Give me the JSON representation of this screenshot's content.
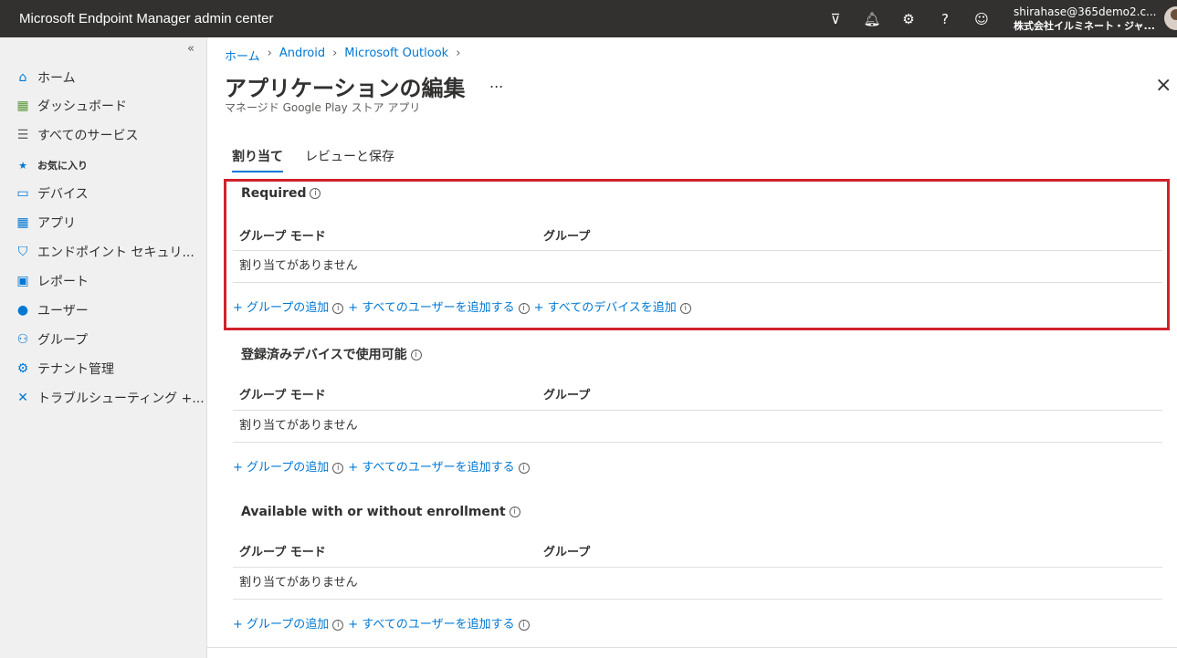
{
  "topbar": {
    "title": "Microsoft Endpoint Manager admin center",
    "user_email": "shirahase@365demo2.c...",
    "user_tenant": "株式会社イルミネート・ジャ..."
  },
  "sidebar": {
    "collapse_glyph": "«",
    "items": [
      {
        "label": "ホーム",
        "icon": "home-icon"
      },
      {
        "label": "ダッシュボード",
        "icon": "dashboard-icon"
      },
      {
        "label": "すべてのサービス",
        "icon": "list-icon"
      },
      {
        "label": "お気に入り",
        "icon": "star-icon"
      },
      {
        "label": "デバイス",
        "icon": "devices-icon"
      },
      {
        "label": "アプリ",
        "icon": "apps-icon"
      },
      {
        "label": "エンドポイント セキュリ...",
        "icon": "shield-icon"
      },
      {
        "label": "レポート",
        "icon": "report-icon"
      },
      {
        "label": "ユーザー",
        "icon": "user-icon"
      },
      {
        "label": "グループ",
        "icon": "group-icon"
      },
      {
        "label": "テナント管理",
        "icon": "tenant-icon"
      },
      {
        "label": "トラブルシューティング +...",
        "icon": "wrench-icon"
      }
    ]
  },
  "breadcrumb": [
    "ホーム",
    "Android",
    "Microsoft Outlook"
  ],
  "page": {
    "title": "アプリケーションの編集",
    "ellipsis": "...",
    "subtitle": "マネージド Google Play ストア アプリ",
    "close": "×"
  },
  "tabs": [
    {
      "label": "割り当て",
      "active": true
    },
    {
      "label": "レビューと保存",
      "active": false
    }
  ],
  "columns": {
    "mode": "グループ モード",
    "group": "グループ"
  },
  "empty_text": "割り当てがありません",
  "sections": [
    {
      "title": "Required",
      "actions": [
        "+ グループの追加",
        "+ すべてのユーザーを追加する",
        "+ すべてのデバイスを追加"
      ]
    },
    {
      "title": "登録済みデバイスで使用可能",
      "actions": [
        "+ グループの追加",
        "+ すべてのユーザーを追加する"
      ]
    },
    {
      "title": "Available with or without enrollment",
      "actions": [
        "+ グループの追加",
        "+ すべてのユーザーを追加する"
      ]
    }
  ],
  "colors": {
    "accent": "#0078d4",
    "highlight": "#d0222a",
    "topbar": "#323130"
  }
}
